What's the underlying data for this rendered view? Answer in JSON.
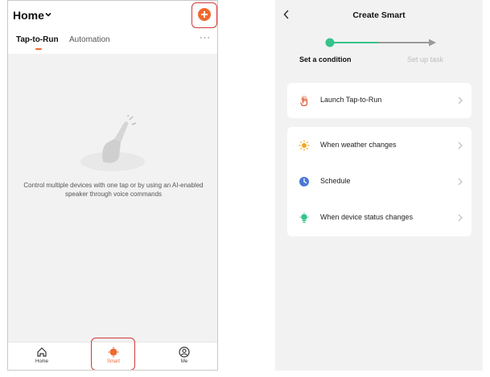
{
  "left_screen": {
    "header": {
      "title": "Home"
    },
    "tabs": [
      {
        "label": "Tap-to-Run",
        "active": true
      },
      {
        "label": "Automation",
        "active": false
      }
    ],
    "more_label": "···",
    "empty_state": {
      "text": "Control multiple devices with one tap or by using an AI-enabled speaker through voice commands"
    },
    "bottom_nav": [
      {
        "label": "Home",
        "icon": "home-icon",
        "active": false
      },
      {
        "label": "Smart",
        "icon": "smart-icon",
        "active": true
      },
      {
        "label": "Me",
        "icon": "user-icon",
        "active": false
      }
    ]
  },
  "right_screen": {
    "title": "Create Smart",
    "progress": {
      "steps": [
        "Set a condition",
        "Set up task"
      ],
      "current_step": 1
    },
    "cards": [
      {
        "rows": [
          {
            "label": "Launch Tap-to-Run",
            "icon": "hand-tap-icon"
          }
        ]
      },
      {
        "rows": [
          {
            "label": "When weather changes",
            "icon": "sun-icon"
          },
          {
            "label": "Schedule",
            "icon": "clock-icon"
          },
          {
            "label": "When device status changes",
            "icon": "device-icon"
          }
        ]
      }
    ]
  },
  "colors": {
    "accent": "#ee6a2f",
    "highlight_box": "#d23a3a",
    "progress_green": "#35c48a",
    "background": "#f2f2f2"
  }
}
